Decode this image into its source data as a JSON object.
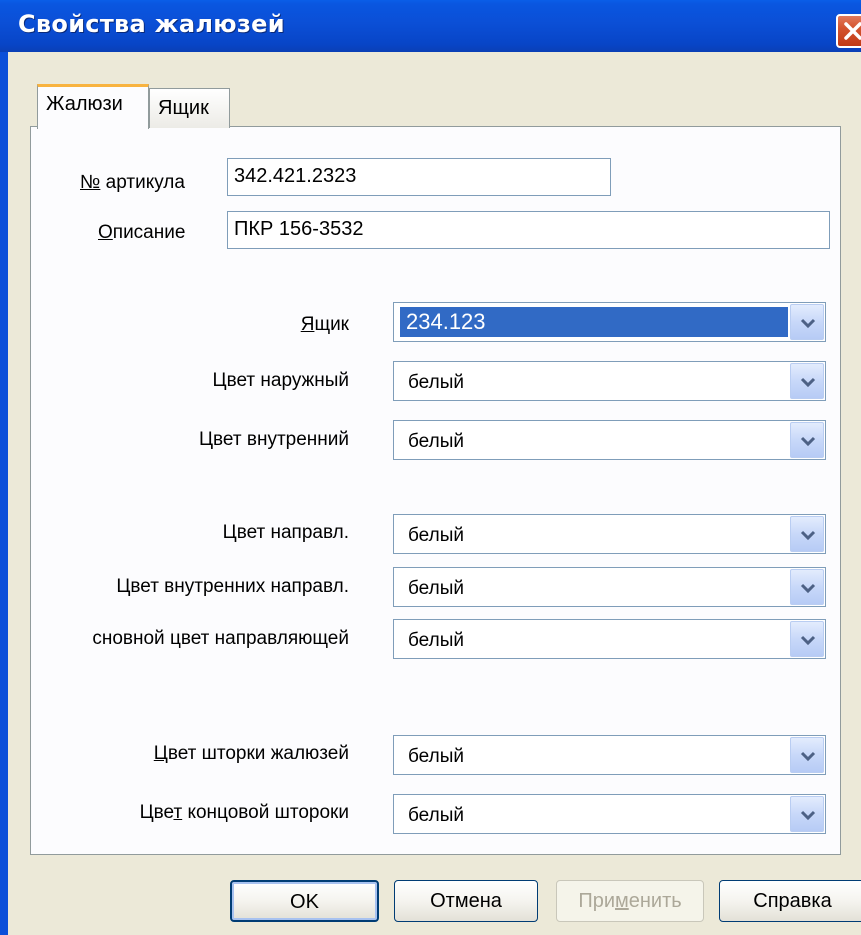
{
  "window": {
    "title": "Свойства жалюзей"
  },
  "tabs": [
    {
      "label": "Жалюзи",
      "active": true
    },
    {
      "label": "Ящик",
      "active": false
    }
  ],
  "fields": {
    "article_label_prefix": "№",
    "article_label_rest": " артикула",
    "article_value": "342.421.2323",
    "description_label_first": "О",
    "description_label_rest": "писание",
    "description_value": "ПКР 156-3532"
  },
  "combos": [
    {
      "label_u": "Я",
      "label_rest": "щик",
      "label_pre": "",
      "value": "234.123",
      "selected": true
    },
    {
      "label_pre": "Цвет наружный",
      "label_u": "",
      "label_rest": "",
      "value": "белый",
      "selected": false
    },
    {
      "label_pre": "Цвет внутренний",
      "label_u": "",
      "label_rest": "",
      "value": "белый",
      "selected": false
    },
    {
      "label_pre": "Цвет направл.",
      "label_u": "",
      "label_rest": "",
      "value": "белый",
      "selected": false
    },
    {
      "label_pre": "Цвет внутренних направл.",
      "label_u": "",
      "label_rest": "",
      "value": "белый",
      "selected": false
    },
    {
      "label_pre": "сновной цвет направляющей",
      "label_u": "",
      "label_rest": "",
      "value": "белый",
      "selected": false
    },
    {
      "label_pre": "",
      "label_u": "Ц",
      "label_rest": "вет шторки жалюзей",
      "value": "белый",
      "selected": false
    },
    {
      "label_pre": "Цве",
      "label_u": "т",
      "label_rest": " концовой штороки",
      "value": "белый",
      "selected": false
    }
  ],
  "buttons": {
    "ok": "OK",
    "cancel": "Отмена",
    "apply_pre": "При",
    "apply_u": "м",
    "apply_rest": "енить",
    "help": "Справка"
  },
  "colors": {
    "titlebar": "#0b4fd6",
    "selection": "#316ac5",
    "tab_highlight": "#f8b340"
  }
}
